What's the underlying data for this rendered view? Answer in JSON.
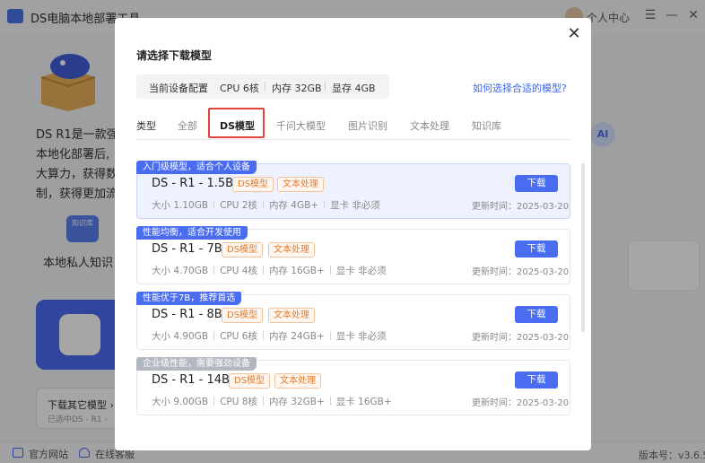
{
  "app": {
    "title": "DS电脑本地部署工具",
    "user_label": "个人中心",
    "hero_text_lines": [
      "DS R1是一款强",
      "本地化部署后,",
      "大算力，获得数",
      "制，获得更加流"
    ],
    "kb_icon_text": "知识库",
    "kb_label": "本地私人知识",
    "other_model_title": "下载其它模型 ›",
    "other_model_sub": "已选中DS - R1 -",
    "footer": {
      "website": "官方网站",
      "support": "在线客服",
      "version": "版本号：v3.6.5"
    }
  },
  "modal": {
    "title": "请选择下载模型",
    "config": {
      "label": "当前设备配置",
      "cpu": "CPU 6核",
      "memory": "内存 32GB",
      "gpu": "显存 4GB"
    },
    "help_link": "如何选择合适的模型?",
    "tabs": {
      "label": "类型",
      "items": [
        "全部",
        "DS模型",
        "千问大模型",
        "图片识别",
        "文本处理",
        "知识库"
      ],
      "active": "DS模型"
    },
    "models": [
      {
        "ribbon": "入门级模型，适合个人设备",
        "name": "DS - R1 - 1.5B",
        "tags": [
          "DS模型",
          "文本处理"
        ],
        "size": "大小 1.10GB",
        "cpu": "CPU 2核",
        "memory": "内存 4GB+",
        "gpu": "显卡 非必须",
        "update": "更新时间：2025-03-20",
        "download": "下载"
      },
      {
        "ribbon": "性能均衡，适合开发使用",
        "name": "DS - R1 - 7B",
        "tags": [
          "DS模型",
          "文本处理"
        ],
        "size": "大小 4.70GB",
        "cpu": "CPU 4核",
        "memory": "内存 16GB+",
        "gpu": "显卡 非必须",
        "update": "更新时间：2025-03-20",
        "download": "下载"
      },
      {
        "ribbon": "性能优于7B，推荐首选",
        "name": "DS - R1 - 8B",
        "tags": [
          "DS模型",
          "文本处理"
        ],
        "size": "大小 4.90GB",
        "cpu": "CPU 6核",
        "memory": "内存 24GB+",
        "gpu": "显卡 非必须",
        "update": "更新时间：2025-03-20",
        "download": "下载"
      },
      {
        "ribbon": "企业级性能，需要强劲设备",
        "name": "DS - R1 - 14B",
        "tags": [
          "DS模型",
          "文本处理"
        ],
        "size": "大小 9.00GB",
        "cpu": "CPU 8核",
        "memory": "内存 32GB+",
        "gpu": "显卡 16GB+",
        "update": "更新时间：2025-03-20",
        "download": "下载"
      }
    ]
  },
  "colors": {
    "accent": "#4a6cf0",
    "tag_orange": "#e57a2a",
    "highlight_red": "#e0443a",
    "ribbon_gray": "#b3b7c0"
  }
}
